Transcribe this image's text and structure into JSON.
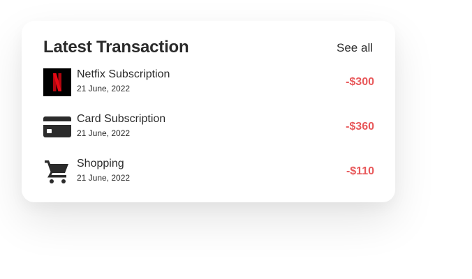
{
  "card": {
    "title": "Latest Transaction",
    "see_all_label": "See all"
  },
  "transactions": [
    {
      "icon": "netflix-logo-icon",
      "title": "Netfix Subscription",
      "date": "21 June, 2022",
      "amount": "-$300"
    },
    {
      "icon": "credit-card-icon",
      "title": "Card Subscription",
      "date": "21 June, 2022",
      "amount": "-$360"
    },
    {
      "icon": "shopping-cart-icon",
      "title": "Shopping",
      "date": "21 June, 2022",
      "amount": "-$110"
    }
  ],
  "colors": {
    "amount_negative": "#e8585a",
    "text_primary": "#2b2b2b",
    "netflix_red": "#e50914",
    "icon_dark": "#2b2b2b"
  }
}
